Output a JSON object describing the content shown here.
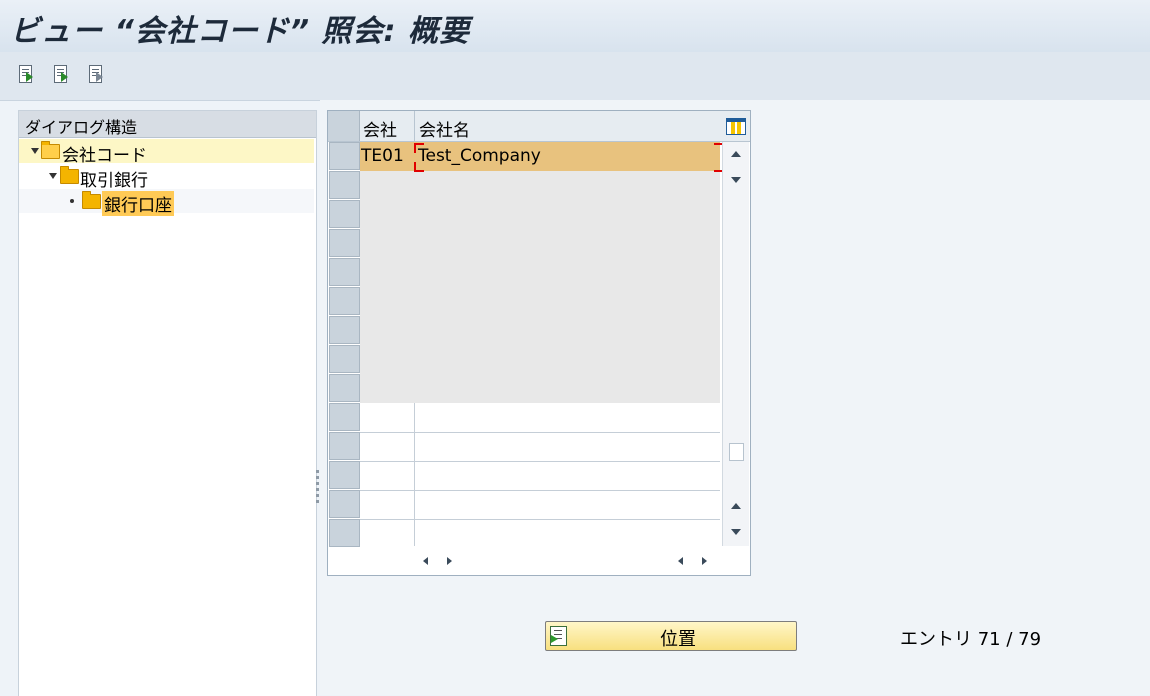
{
  "window": {
    "title": "ビュー “会社コード” 照会: 概要"
  },
  "toolbar": {
    "icons": [
      "select-detail-icon",
      "next-entry-icon",
      "other-view-icon"
    ]
  },
  "tree": {
    "header": "ダイアログ構造",
    "items": [
      {
        "label": "会社コード",
        "level": 0,
        "icon": "folder-open-icon",
        "selected": true
      },
      {
        "label": "取引銀行",
        "level": 1,
        "icon": "folder-icon",
        "selected": false
      },
      {
        "label": "銀行口座",
        "level": 2,
        "icon": "folder-icon",
        "selected": false
      }
    ]
  },
  "table": {
    "columns": [
      "会社",
      "会社名"
    ],
    "rows": [
      {
        "code": "TE01",
        "name": "Test_Company"
      }
    ],
    "settings_icon": "table-settings-icon"
  },
  "footer": {
    "position_button": "位置",
    "entry_text": "エントリ 71 / 79"
  },
  "colors": {
    "highlight_row": "#e8c27e",
    "button_bg": "#f8e07f",
    "selected_tree": "#ffca56"
  }
}
